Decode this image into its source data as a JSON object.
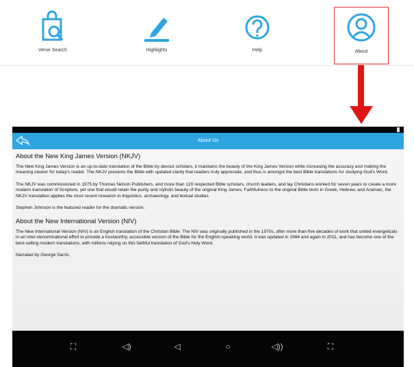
{
  "toolbar": {
    "items": [
      {
        "label": "Verse Search",
        "icon": "shopping-bag-search-icon"
      },
      {
        "label": "Highlights",
        "icon": "pencil-icon"
      },
      {
        "label": "Help",
        "icon": "question-circle-icon"
      },
      {
        "label": "About",
        "icon": "user-circle-icon",
        "selected": true
      }
    ]
  },
  "colors": {
    "accent": "#2ea5e1",
    "callout": "#e01515"
  },
  "app": {
    "title": "About Us",
    "sections": [
      {
        "heading": "About the New King James Version (NKJV)",
        "paragraphs": [
          "The New King James Version is an up-to-date translation of the Bible by devout scholars, it maintains the beauty of the King James Version while increasing the accuracy and making the meaning clearer for today's reader. The NKJV presents the Bible with updated clarity that readers truly appreciate, and thus is amongst the best Bible translations for studying God's Word.",
          "The NKJV was commissioned in 1975 by Thomas Nelson Publishers, and more than 120 respected Bible scholars, church leaders, and lay Christians worked for seven years to create a more modern translation of Scripture, yet one that would retain the purity and stylistic beauty of the original King James. Faithfulness to the original Bible texts in Greek, Hebrew, and Aramaic, the NKJV translation applies the most recent research in linguistics, archaeology, and textual studies.",
          "Stephen Johnson is the featured reader for the dramatic version."
        ]
      },
      {
        "heading": "About the New International Version (NIV)",
        "paragraphs": [
          "The New International Version (NIV) is an English translation of the Christian Bible. The NIV was originally published in the 1970s, after more than five decades of work that united evangelicals in an inter-denominational effort to provide a trustworthy, accessible version of the Bible for the English-speaking world. It was updated in 1984 and again in 2011, and has become one of the best-selling modern translations, with millions relying on this faithful translation of God's Holy Word.",
          "Narrated by George Sarris."
        ]
      }
    ]
  },
  "navbar": {
    "buttons": [
      {
        "glyph": "⛶",
        "icon": "screenshot-icon"
      },
      {
        "glyph": "◁)",
        "icon": "volume-down-icon"
      },
      {
        "glyph": "◁",
        "icon": "back-icon"
      },
      {
        "glyph": "○",
        "icon": "home-icon"
      },
      {
        "glyph": "◁))",
        "icon": "volume-up-icon"
      },
      {
        "glyph": "⛶",
        "icon": "fullscreen-icon"
      }
    ]
  }
}
